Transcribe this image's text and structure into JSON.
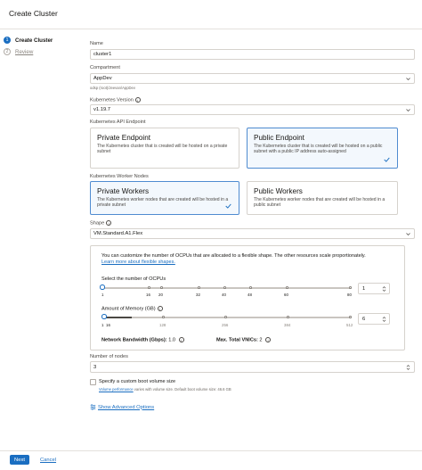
{
  "header": {
    "title": "Create Cluster"
  },
  "steps": [
    {
      "num": "1",
      "label": "Create Cluster"
    },
    {
      "num": "2",
      "label": "Review"
    }
  ],
  "name": {
    "label": "Name",
    "value": "cluster1"
  },
  "compartment": {
    "label": "Compartment",
    "value": "AppDev",
    "path": "odsp (root)/Jeevan/AppDev"
  },
  "k8s_version": {
    "label": "Kubernetes Version",
    "value": "v1.19.7"
  },
  "api_endpoint": {
    "label": "Kubernetes API Endpoint",
    "private": {
      "title": "Private Endpoint",
      "desc": "The Kubernetes cluster that is created will be hosted on a private subnet"
    },
    "public": {
      "title": "Public Endpoint",
      "desc": "The Kubernetes cluster that is created will be hosted on a public subnet with a public IP address auto-assigned"
    }
  },
  "worker_nodes": {
    "label": "Kubernetes Worker Nodes",
    "private": {
      "title": "Private Workers",
      "desc": "The Kubernetes worker nodes that are created will be hosted in a private subnet"
    },
    "public": {
      "title": "Public Workers",
      "desc": "The Kubernetes worker nodes that are created will be hosted in a public subnet"
    }
  },
  "shape": {
    "label": "Shape",
    "value": "VM.Standard.A1.Flex",
    "info_text": "You can customize the number of OCPUs that are allocated to a flexible shape. The other resources scale proportionately.",
    "info_link": "Learn more about flexible shapes.",
    "ocpu": {
      "label": "Select the number of OCPUs",
      "ticks": [
        "1",
        "16",
        "20",
        "32",
        "40",
        "48",
        "60",
        "80"
      ],
      "value": "1"
    },
    "memory": {
      "label": "Amount of Memory (GB)",
      "ticks": [
        "16",
        "128",
        "256",
        "384",
        "512"
      ],
      "min": "1",
      "value": "6"
    },
    "bandwidth_label": "Network Bandwidth (Gbps):",
    "bandwidth_value": "1.0",
    "vnics_label": "Max. Total VNICs:",
    "vnics_value": "2"
  },
  "nodes": {
    "label": "Number of nodes",
    "value": "3"
  },
  "boot_volume": {
    "label": "Specify a custom boot volume size",
    "note_link": "Volume performance",
    "note_rest": " varies with volume size. Default boot volume size: 46.6 GB"
  },
  "advanced_link": "Show Advanced Options",
  "footer": {
    "next": "Next",
    "cancel": "Cancel"
  },
  "colors": {
    "accent": "#1a6ec1",
    "selected_border": "#4f8bd0",
    "selected_bg": "#f3f8fd"
  }
}
